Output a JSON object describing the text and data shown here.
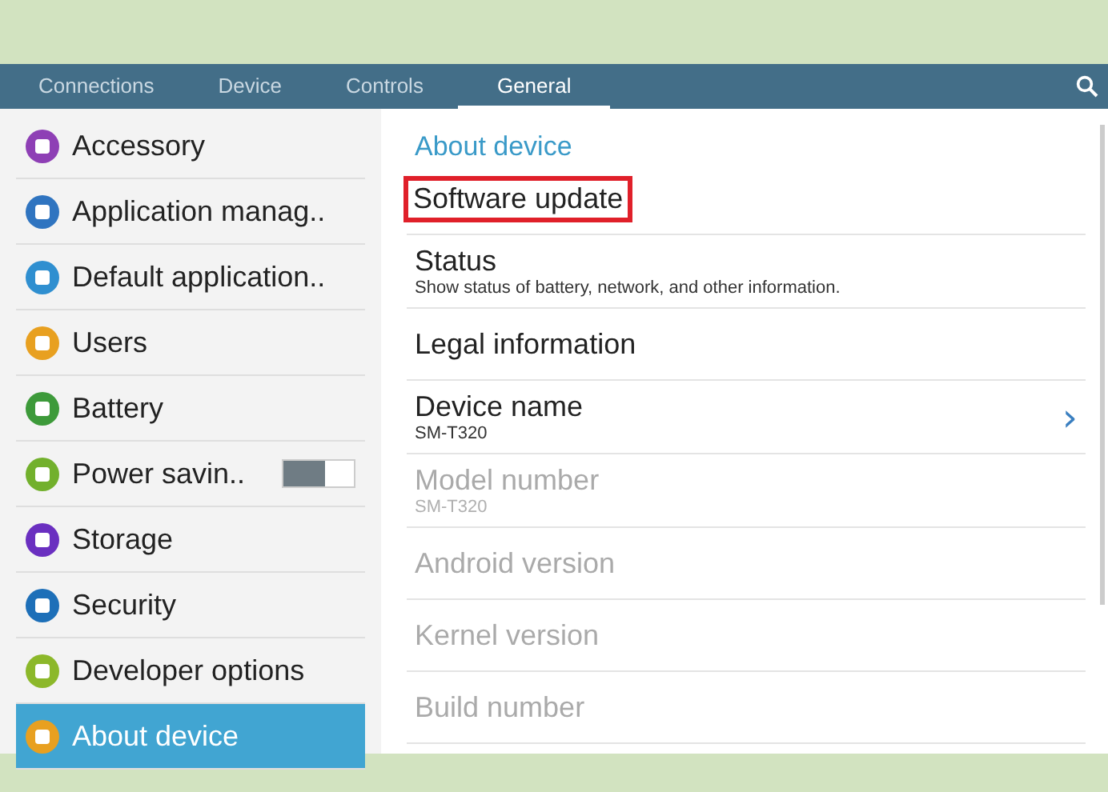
{
  "tabs": [
    {
      "label": "Connections",
      "selected": false
    },
    {
      "label": "Device",
      "selected": false
    },
    {
      "label": "Controls",
      "selected": false
    },
    {
      "label": "General",
      "selected": true
    }
  ],
  "sidebar": {
    "items": [
      {
        "label": "Accessory",
        "color": "#8e3fb5",
        "selected": false
      },
      {
        "label": "Application manag..",
        "color": "#2f74c0",
        "selected": false
      },
      {
        "label": "Default application..",
        "color": "#2f8fd0",
        "selected": false
      },
      {
        "label": "Users",
        "color": "#e8a020",
        "selected": false
      },
      {
        "label": "Battery",
        "color": "#3d9a3a",
        "selected": false
      },
      {
        "label": "Power savin..",
        "color": "#72b02c",
        "selected": false,
        "toggle": {
          "on": false
        }
      },
      {
        "label": "Storage",
        "color": "#6a2fc0",
        "selected": false
      },
      {
        "label": "Security",
        "color": "#1d6fb8",
        "selected": false
      },
      {
        "label": "Developer options",
        "color": "#8cb82a",
        "selected": false
      },
      {
        "label": "About device",
        "color": "#e8a020",
        "selected": true
      }
    ]
  },
  "content": {
    "heading": "About device",
    "items": [
      {
        "title": "Software update",
        "highlighted": true,
        "disabled": false
      },
      {
        "title": "Status",
        "subtitle": "Show status of battery, network, and other information.",
        "highlighted": false,
        "disabled": false
      },
      {
        "title": "Legal information",
        "highlighted": false,
        "disabled": false
      },
      {
        "title": "Device name",
        "subtitle": "SM-T320",
        "highlighted": false,
        "disabled": false,
        "chevron": "›"
      },
      {
        "title": "Model number",
        "subtitle": "SM-T320",
        "highlighted": false,
        "disabled": true
      },
      {
        "title": "Android version",
        "highlighted": false,
        "disabled": true
      },
      {
        "title": "Kernel version",
        "highlighted": false,
        "disabled": true
      },
      {
        "title": "Build number",
        "highlighted": false,
        "disabled": true
      }
    ]
  }
}
